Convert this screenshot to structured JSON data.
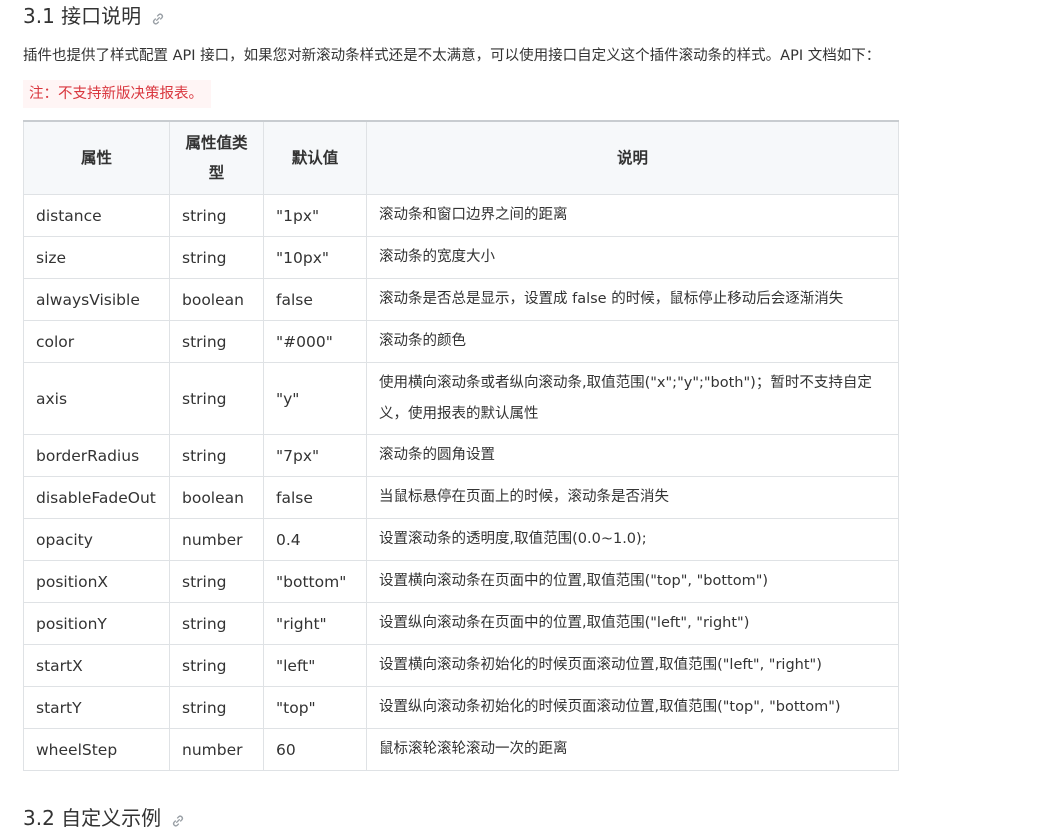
{
  "heading1": "3.1 接口说明",
  "intro": "插件也提供了样式配置 API 接口，如果您对新滚动条样式还是不太满意，可以使用接口自定义这个插件滚动条的样式。API 文档如下：",
  "note": "注：不支持新版决策报表。",
  "table": {
    "headers": [
      "属性",
      "属性值类型",
      "默认值",
      "说明"
    ],
    "rows": [
      {
        "name": "distance",
        "type": "string",
        "default": "\"1px\"",
        "desc": "滚动条和窗口边界之间的距离"
      },
      {
        "name": "size",
        "type": "string",
        "default": "\"10px\"",
        "desc": "滚动条的宽度大小"
      },
      {
        "name": "alwaysVisible",
        "type": "boolean",
        "default": "false",
        "desc": "滚动条是否总是显示，设置成 false 的时候，鼠标停止移动后会逐渐消失"
      },
      {
        "name": "color",
        "type": "string",
        "default": "\"#000\"",
        "desc": "滚动条的颜色"
      },
      {
        "name": "axis",
        "type": "string",
        "default": "\"y\"",
        "desc": "使用横向滚动条或者纵向滚动条,取值范围(\"x\";\"y\";\"both\")；暂时不支持自定义，使用报表的默认属性"
      },
      {
        "name": "borderRadius",
        "type": "string",
        "default": "\"7px\"",
        "desc": "滚动条的圆角设置"
      },
      {
        "name": "disableFadeOut",
        "type": "boolean",
        "default": "false",
        "desc": "当鼠标悬停在页面上的时候，滚动条是否消失"
      },
      {
        "name": "opacity",
        "type": "number",
        "default": "0.4",
        "desc": "设置滚动条的透明度,取值范围(0.0~1.0);"
      },
      {
        "name": "positionX",
        "type": "string",
        "default": "\"bottom\"",
        "desc": "设置横向滚动条在页面中的位置,取值范围(\"top\", \"bottom\")"
      },
      {
        "name": "positionY",
        "type": "string",
        "default": "\"right\"",
        "desc": "设置纵向滚动条在页面中的位置,取值范围(\"left\", \"right\")"
      },
      {
        "name": "startX",
        "type": "string",
        "default": "\"left\"",
        "desc": "设置横向滚动条初始化的时候页面滚动位置,取值范围(\"left\", \"right\")"
      },
      {
        "name": "startY",
        "type": "string",
        "default": "\"top\"",
        "desc": "设置纵向滚动条初始化的时候页面滚动位置,取值范围(\"top\", \"bottom\")"
      },
      {
        "name": "wheelStep",
        "type": "number",
        "default": "60",
        "desc": "鼠标滚轮滚轮滚动一次的距离"
      }
    ]
  },
  "heading2": "3.2 自定义示例",
  "colors": {
    "note_text": "#d9363e",
    "note_bg": "#fff5f5",
    "header_bg": "#f6f8fa",
    "border": "#dfe2e5"
  }
}
